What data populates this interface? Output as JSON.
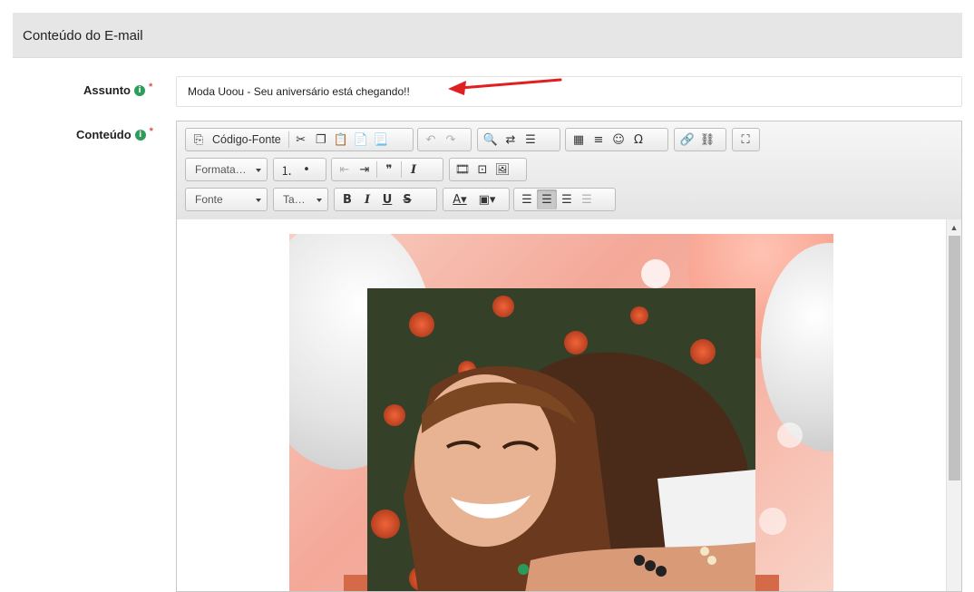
{
  "section": {
    "title": "Conteúdo do E-mail"
  },
  "subject": {
    "label": "Assunto",
    "value": "Moda Uoou - Seu aniversário está chegando!!"
  },
  "content": {
    "label": "Conteúdo"
  },
  "toolbar": {
    "source_label": "Código-Fonte",
    "format_combo": "Formata…",
    "font_combo": "Fonte",
    "size_combo": "Ta…"
  },
  "icons": {
    "info": "i",
    "required": "*"
  },
  "colors": {
    "info_badge": "#2e9c5a",
    "required_star": "#d9534f",
    "arrow": "#e02020",
    "header_bg": "#e6e6e6"
  }
}
